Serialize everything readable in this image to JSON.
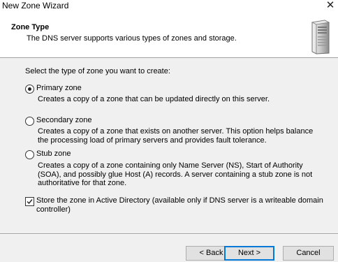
{
  "window": {
    "title": "New Zone Wizard",
    "close_glyph": "✕"
  },
  "header": {
    "title": "Zone Type",
    "subtitle": "The DNS server supports various types of zones and storage."
  },
  "main": {
    "prompt": "Select the type of zone you want to create:",
    "options": [
      {
        "label": "Primary zone",
        "selected": true,
        "description": "Creates a copy of a zone that can be updated directly on this server."
      },
      {
        "label": "Secondary zone",
        "selected": false,
        "description": "Creates a copy of a zone that exists on another server. This option helps balance the processing load of primary servers and provides fault tolerance."
      },
      {
        "label": "Stub zone",
        "selected": false,
        "description": "Creates a copy of a zone containing only Name Server (NS), Start of Authority (SOA), and possibly glue Host (A) records. A server containing a stub zone is not authoritative for that zone."
      }
    ],
    "ad_checkbox": {
      "label": "Store the zone in Active Directory (available only if DNS server is a writeable domain controller)",
      "checked": true
    }
  },
  "footer": {
    "back_label": "< Back",
    "next_label": "Next >",
    "cancel_label": "Cancel"
  },
  "icons": {
    "close": "close-icon",
    "server": "server-tower-icon"
  },
  "colors": {
    "accent_border": "#0078d7",
    "button_face": "#e1e1e1",
    "dialog_bg": "#f0f0f0"
  }
}
